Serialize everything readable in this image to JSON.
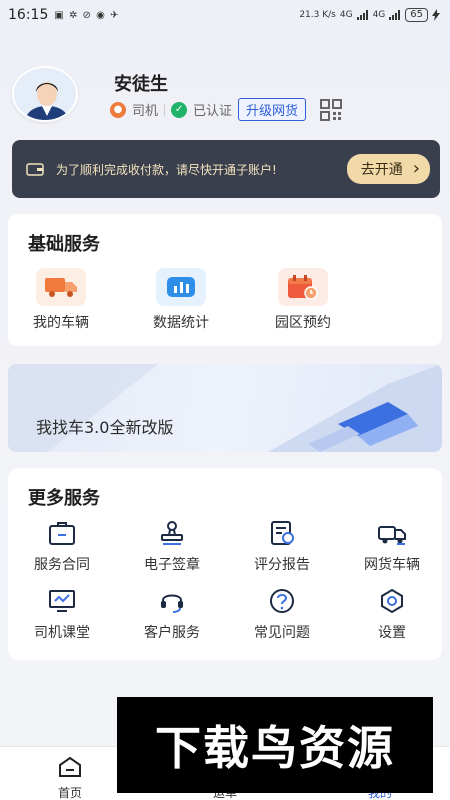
{
  "status_bar": {
    "time": "16:15",
    "left_icons": "▣ ✲ ⊘ ◉ ✈",
    "net_speed": "21.3 K/s",
    "signal1": "4G",
    "signal2": "4G",
    "battery": "65"
  },
  "profile": {
    "name": "安徒生",
    "role": "司机",
    "verified": "已认证",
    "upgrade_label": "升级网货"
  },
  "notice": {
    "text": "为了顺利完成收付款，请尽快开通子账户!",
    "button_label": "去开通",
    "chevron": "›"
  },
  "basic_services": {
    "title": "基础服务",
    "items": [
      {
        "label": "我的车辆",
        "icon": "truck-icon"
      },
      {
        "label": "数据统计",
        "icon": "chart-icon"
      },
      {
        "label": "园区预约",
        "icon": "calendar-icon"
      }
    ]
  },
  "banner": {
    "text": "我找车3.0全新改版"
  },
  "more_services": {
    "title": "更多服务",
    "items": [
      {
        "label": "服务合同",
        "icon": "briefcase-icon"
      },
      {
        "label": "电子签章",
        "icon": "stamp-icon"
      },
      {
        "label": "评分报告",
        "icon": "report-icon"
      },
      {
        "label": "网货车辆",
        "icon": "vehicle-icon"
      },
      {
        "label": "司机课堂",
        "icon": "classroom-icon"
      },
      {
        "label": "客户服务",
        "icon": "headset-icon"
      },
      {
        "label": "常见问题",
        "icon": "question-icon"
      },
      {
        "label": "设置",
        "icon": "settings-icon"
      }
    ]
  },
  "bottom_nav": {
    "items": [
      {
        "label": "首页",
        "icon": "home-icon"
      },
      {
        "label": "运单",
        "icon": "waybill-icon"
      },
      {
        "label": "我的",
        "icon": "profile-icon"
      }
    ]
  },
  "watermark": {
    "text": "下载鸟资源"
  },
  "colors": {
    "accent": "#2e5fd8",
    "notice_bg": "#3a3f4d",
    "notice_btn": "#f2d9a8",
    "truck": "#f07a3c",
    "chart": "#2f8fe8",
    "calendar": "#f05a3c"
  }
}
